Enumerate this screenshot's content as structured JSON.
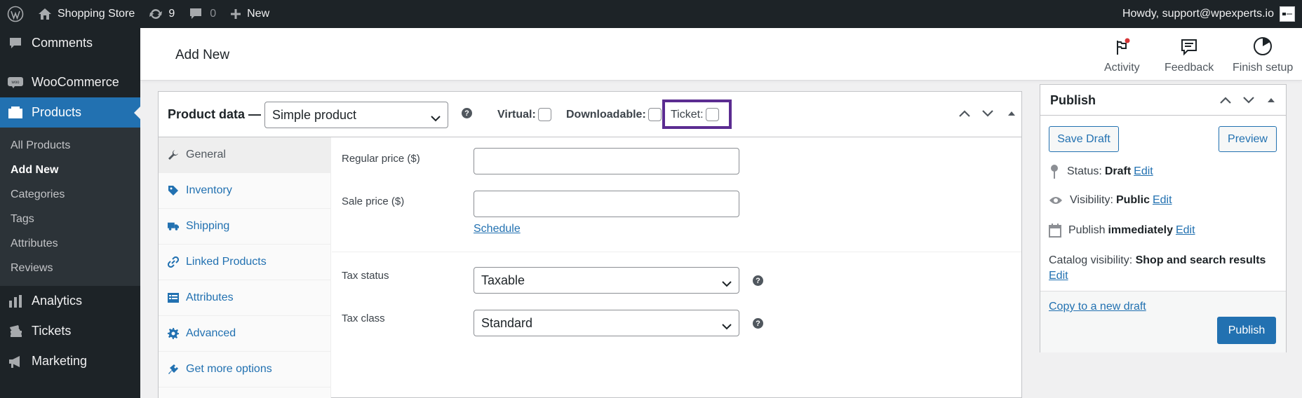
{
  "adminbar": {
    "site_name": "Shopping Store",
    "updates_count": "9",
    "comments_count": "0",
    "new_label": "New",
    "greeting": "Howdy, support@wpexperts.io"
  },
  "sidebar": {
    "top_items": [
      {
        "label": "Comments",
        "icon": "comments-icon"
      },
      {
        "label": "WooCommerce",
        "icon": "woocommerce-icon"
      },
      {
        "label": "Products",
        "icon": "products-icon"
      },
      {
        "label": "Analytics",
        "icon": "analytics-icon"
      },
      {
        "label": "Tickets",
        "icon": "tickets-icon"
      },
      {
        "label": "Marketing",
        "icon": "marketing-icon"
      }
    ],
    "submenu": [
      "All Products",
      "Add New",
      "Categories",
      "Tags",
      "Attributes",
      "Reviews"
    ],
    "active_submenu": "Add New"
  },
  "header": {
    "title": "Add New",
    "buttons": [
      "Activity",
      "Feedback",
      "Finish setup"
    ]
  },
  "product_data": {
    "title": "Product data —",
    "product_type": "Simple product",
    "virtual_label": "Virtual:",
    "downloadable_label": "Downloadable:",
    "ticket_label": "Ticket:",
    "help_glyph": "?",
    "tabs": [
      "General",
      "Inventory",
      "Shipping",
      "Linked Products",
      "Attributes",
      "Advanced",
      "Get more options"
    ],
    "active_tab": "General",
    "general": {
      "regular_price_label": "Regular price ($)",
      "regular_price_value": "",
      "sale_price_label": "Sale price ($)",
      "sale_price_value": "",
      "schedule_link": "Schedule",
      "tax_status_label": "Tax status",
      "tax_status_value": "Taxable",
      "tax_class_label": "Tax class",
      "tax_class_value": "Standard"
    }
  },
  "publish": {
    "title": "Publish",
    "save_draft": "Save Draft",
    "preview": "Preview",
    "status_label": "Status:",
    "status_value": "Draft",
    "visibility_label": "Visibility:",
    "visibility_value": "Public",
    "publish_label": "Publish",
    "publish_value": "immediately",
    "catalog_label": "Catalog visibility:",
    "catalog_value": "Shop and search results",
    "edit": "Edit",
    "copy_draft": "Copy to a new draft",
    "publish_button": "Publish"
  },
  "colors": {
    "admin_dark": "#1d2327",
    "accent_blue": "#2271b1",
    "highlight_purple": "#5b2c91"
  }
}
